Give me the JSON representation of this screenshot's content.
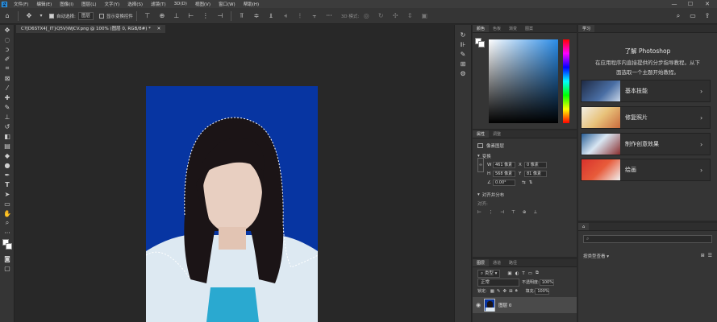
{
  "app": {
    "logo": "Ps"
  },
  "menu": [
    "文件(F)",
    "编辑(E)",
    "图像(I)",
    "图层(L)",
    "文字(Y)",
    "选择(S)",
    "滤镜(T)",
    "3D(D)",
    "视图(V)",
    "窗口(W)",
    "帮助(H)"
  ],
  "window_controls": [
    "—",
    "☐",
    "✕"
  ],
  "options": {
    "auto_select_label": "自动选择:",
    "auto_select_target": "图层",
    "show_transform_label": "显示变换控件",
    "mode3d_label": "3D 模式:"
  },
  "document": {
    "tab_title": "C?[D6STX4[_IT}Q5V)WJCV.png @ 100% (图层 0, RGB/8#) *"
  },
  "color_panel": {
    "tabs": [
      "颜色",
      "色板",
      "渐变",
      "图案"
    ]
  },
  "learn_panel": {
    "tab": "学习",
    "title": "了解 Photoshop",
    "desc_line1": "在应用程序内直接提供的分步指导教程。从下",
    "desc_line2": "面选取一个主题开始教程。",
    "items": [
      {
        "label": "基本技能"
      },
      {
        "label": "修复照片"
      },
      {
        "label": "制作创意效果"
      },
      {
        "label": "绘画"
      }
    ]
  },
  "properties_panel": {
    "tabs": [
      "属性",
      "调整"
    ],
    "kind": "像素图层",
    "transform_label": "变换",
    "w_label": "W",
    "w_value": "461 像素",
    "x_label": "X",
    "x_value": "0 像素",
    "h_label": "H",
    "h_value": "568 像素",
    "y_label": "Y",
    "y_value": "81 像素",
    "angle_value": "0.00°",
    "align_label": "对齐并分布",
    "align_sub": "对齐:"
  },
  "libraries_panel": {
    "filter": "按类型查看"
  },
  "layers_panel": {
    "tabs": [
      "图层",
      "通道",
      "路径"
    ],
    "filter_kind": "类型",
    "blend_mode": "正常",
    "opacity_label": "不透明度:",
    "opacity_value": "100%",
    "lock_label": "锁定:",
    "fill_label": "填充:",
    "fill_value": "100%",
    "layer_name": "图层 0"
  }
}
